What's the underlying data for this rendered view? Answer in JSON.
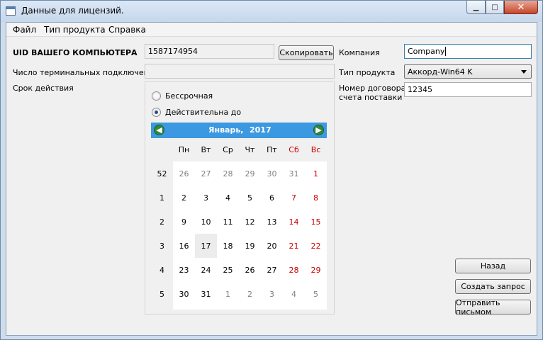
{
  "window": {
    "title": "Данные для лицензий."
  },
  "menu": [
    "Файл",
    "Тип продукта",
    "Справка"
  ],
  "uid": {
    "label": "UID ВАШЕГО КОМПЬЮТЕРА",
    "value": "1587174954",
    "copy_button": "Скопировать"
  },
  "terminals": {
    "label": "Число терминальных подключений",
    "value": ""
  },
  "validity": {
    "label": "Срок действия",
    "option_unlimited": "Бессрочная",
    "option_until": "Действительна до",
    "selected": "option_until"
  },
  "company": {
    "label": "Компания",
    "value": "Company"
  },
  "product_type": {
    "label": "Тип продукта",
    "selected": "Аккорд-Win64 K"
  },
  "contract": {
    "label_line1": "Номер договора/",
    "label_line2": "счета поставки",
    "value": "12345"
  },
  "buttons": {
    "back": "Назад",
    "create_request": "Создать запрос",
    "send_email": "Отправить письмом"
  },
  "calendar": {
    "month": "Январь,",
    "year": "2017",
    "prev_icon": "arrow-left-icon",
    "next_icon": "arrow-right-icon",
    "weekday_headers": [
      "Пн",
      "Вт",
      "Ср",
      "Чт",
      "Пт",
      "Сб",
      "Вс"
    ],
    "weeks": [
      {
        "week": "52",
        "days": [
          "26",
          "27",
          "28",
          "29",
          "30",
          "31",
          "1"
        ]
      },
      {
        "week": "1",
        "days": [
          "2",
          "3",
          "4",
          "5",
          "6",
          "7",
          "8"
        ]
      },
      {
        "week": "2",
        "days": [
          "9",
          "10",
          "11",
          "12",
          "13",
          "14",
          "15"
        ]
      },
      {
        "week": "3",
        "days": [
          "16",
          "17",
          "18",
          "19",
          "20",
          "21",
          "22"
        ]
      },
      {
        "week": "4",
        "days": [
          "23",
          "24",
          "25",
          "26",
          "27",
          "28",
          "29"
        ]
      },
      {
        "week": "5",
        "days": [
          "30",
          "31",
          "1",
          "2",
          "3",
          "4",
          "5"
        ]
      }
    ],
    "selected_day": "17",
    "weekend_color": "#cc0000",
    "header_color": "#3c98e0"
  },
  "colors": {
    "accent": "#3c98e0",
    "weekend": "#cc0000"
  }
}
